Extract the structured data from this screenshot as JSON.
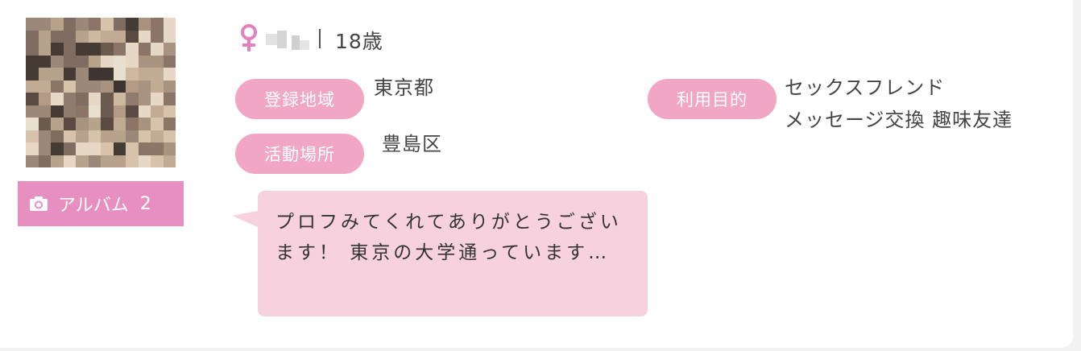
{
  "profile": {
    "album_label": "アルバム",
    "album_count": "2",
    "age": "18歳",
    "region_label": "登録地域",
    "region_value": "東京都",
    "activity_label": "活動場所",
    "activity_value": "豊島区",
    "purpose_label": "利用目的",
    "purpose_line1": "セックスフレンド",
    "purpose_line2": "メッセージ交換 趣味友達",
    "message": "プロフみてくれてありがとうございます！ 東京の大学通っています…"
  },
  "icons": {
    "gender": "female-icon",
    "camera": "camera-icon"
  },
  "colors": {
    "album_button": "#e88fc2",
    "tag_pill": "#f1a6c4",
    "bubble": "#f7d2de",
    "gender_icon": "#e67fbd"
  }
}
